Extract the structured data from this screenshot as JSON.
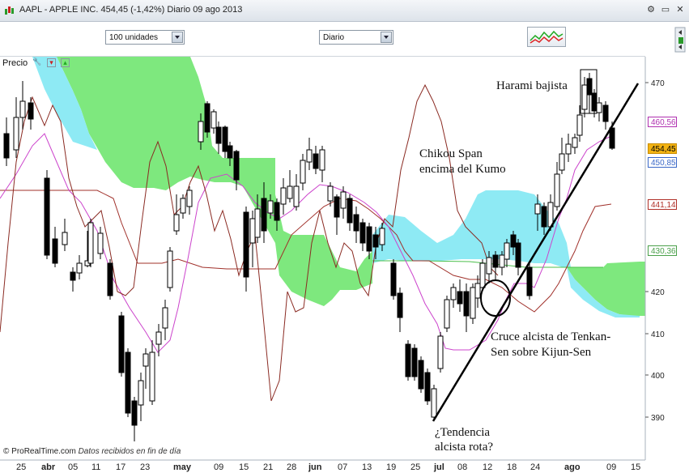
{
  "window": {
    "title": "AAPL - APPLE INC.    454,45 (-1,42%)    Diario  09 ago 2013"
  },
  "toolbar": {
    "units_select": "100 unidades",
    "period_select": "Diario"
  },
  "panel": {
    "label": "Precio"
  },
  "footer": {
    "brand": "© ProRealTime.com",
    "note": "Datos recibidos en fin de día"
  },
  "y_axis": {
    "ticks": [
      "470",
      "420",
      "410",
      "400",
      "390"
    ],
    "tags": {
      "t460": "460,56",
      "t454": "454,45",
      "t450": "450,85",
      "t441": "441,14",
      "t430": "430,36"
    }
  },
  "x_axis": {
    "labels": [
      "25",
      "abr",
      "05",
      "11",
      "17",
      "23",
      "may",
      "09",
      "15",
      "21",
      "28",
      "jun",
      "07",
      "13",
      "19",
      "25",
      "jul",
      "08",
      "12",
      "18",
      "24",
      "ago",
      "09",
      "15"
    ]
  },
  "annotations": {
    "harami": "Harami bajista",
    "chikou_1": "Chikou Span",
    "chikou_2": "encima del Kumo",
    "cruce_1": "Cruce alcista de Tenkan-",
    "cruce_2": "Sen sobre Kijun-Sen",
    "tend_1": "¿Tendencia",
    "tend_2": "alcista rota?"
  },
  "colors": {
    "kumo_green": "#7ee87e",
    "kumo_cyan": "#8eeaf4",
    "tenkan": "#cc44cc",
    "kijun": "#a0302a",
    "chikou": "#8a2a22",
    "tag_magenta": "#b030b0",
    "tag_close": "#f3b312",
    "tag_blue": "#3a68c8",
    "tag_red": "#b03028",
    "tag_green": "#4aa04a"
  }
}
